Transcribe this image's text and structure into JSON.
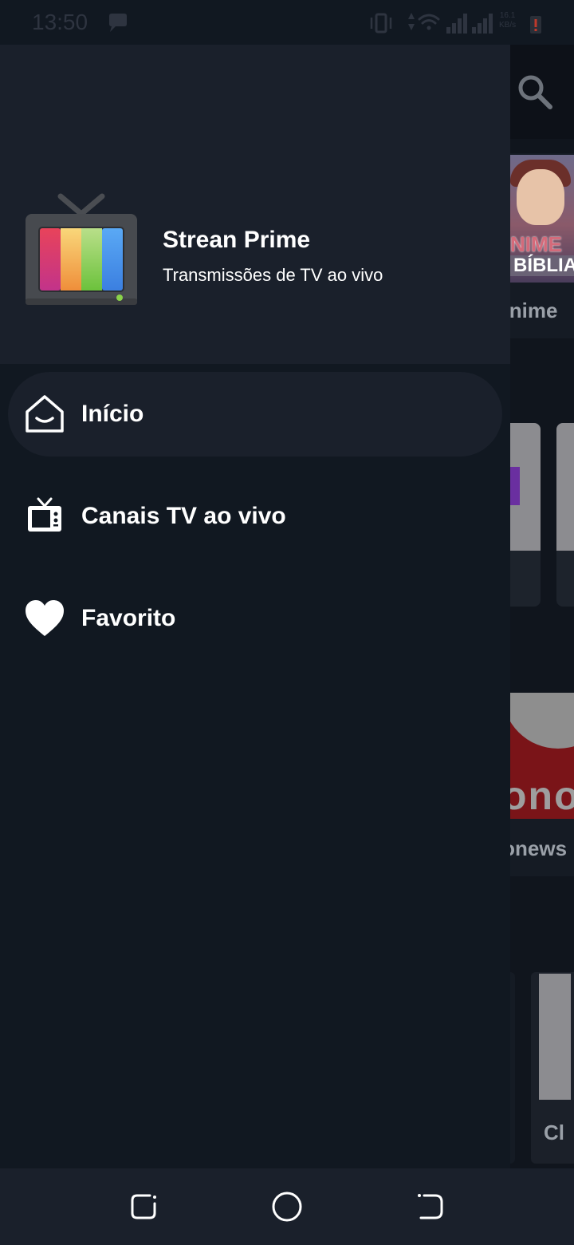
{
  "status_bar": {
    "time": "13:50",
    "net_speed_value": "16.1",
    "net_speed_unit": "KB/s"
  },
  "drawer": {
    "app_name": "Strean Prime",
    "app_subtitle": "Transmissões de TV ao vivo",
    "items": [
      {
        "label": "Início",
        "icon": "home-icon",
        "active": true
      },
      {
        "label": "Canais TV ao vivo",
        "icon": "tv-icon",
        "active": false
      },
      {
        "label": "Favorito",
        "icon": "heart-icon",
        "active": false
      }
    ]
  },
  "background": {
    "card1_label": "Anime",
    "card1_thumb_line1": "NIME",
    "card1_thumb_line2": "BÍBLIA",
    "card4_label": "ronews",
    "card4_thumb_text": "ono",
    "card6_label": "Cl"
  },
  "colors": {
    "drawer_bg": "#111821",
    "header_bg": "#1a202b",
    "active_item_bg": "#1a202b",
    "text": "#ffffff"
  }
}
